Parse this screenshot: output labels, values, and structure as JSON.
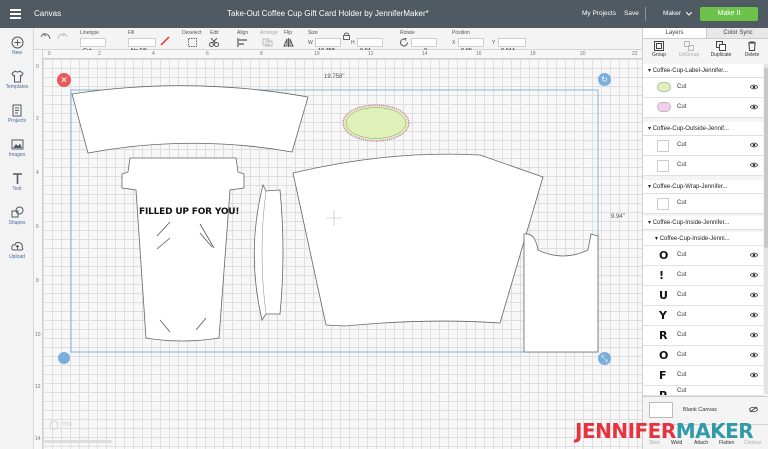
{
  "topbar": {
    "canvas_label": "Canvas",
    "doc_title": "Take-Out Coffee Cup Gift Card Holder by JenniferMaker*",
    "my_projects": "My Projects",
    "save": "Save",
    "machine": "Maker",
    "make_it": "Make It"
  },
  "toolbar": {
    "linetype_label": "Linetype",
    "linetype_value": "Cut",
    "fill_label": "Fill",
    "fill_value": "No Fill",
    "deselect_label": "Deselect",
    "edit_label": "Edit",
    "align_label": "Align",
    "arrange_label": "Arrange",
    "flip_label": "Flip",
    "size_label": "Size",
    "w_label": "W",
    "w_value": "19.758",
    "h_label": "H",
    "h_value": "9.94",
    "rotate_label": "Rotate",
    "rotate_value": "0",
    "position_label": "Position",
    "x_label": "X",
    "x_value": "0.99",
    "y_label": "Y",
    "y_value": "0.944"
  },
  "leftbar": {
    "items": [
      {
        "label": "New",
        "icon": "plus-icon"
      },
      {
        "label": "Templates",
        "icon": "shirt-icon"
      },
      {
        "label": "Projects",
        "icon": "projects-icon"
      },
      {
        "label": "Images",
        "icon": "image-icon"
      },
      {
        "label": "Text",
        "icon": "text-icon"
      },
      {
        "label": "Shapes",
        "icon": "shapes-icon"
      },
      {
        "label": "Upload",
        "icon": "upload-icon"
      }
    ]
  },
  "canvas": {
    "ruler_top": [
      "0",
      "2",
      "4",
      "6",
      "8",
      "10",
      "12",
      "14",
      "16",
      "18",
      "20",
      "22"
    ],
    "ruler_left": [
      "0",
      "2",
      "4",
      "6",
      "8",
      "10",
      "12",
      "14"
    ],
    "width_readout": "19.758\"",
    "height_readout": "9.94\"",
    "cup_text": "FILLED UP FOR YOU!",
    "zoom": "75%"
  },
  "panel": {
    "tabs": [
      "Layers",
      "Color Sync"
    ],
    "tools": [
      "Group",
      "UnGroup",
      "Duplicate",
      "Delete"
    ],
    "groups": [
      {
        "name": "Coffee-Cup-Label-Jennifer...",
        "layers": [
          {
            "label": "Cut",
            "color": "#dff0b8"
          },
          {
            "label": "Cut",
            "color": "#f3cdee"
          }
        ]
      },
      {
        "name": "Coffee-Cup-Outside-Jennif...",
        "layers": [
          {
            "label": "Cut",
            "color": "#ffffff"
          },
          {
            "label": "Cut",
            "color": "#ffffff"
          }
        ]
      },
      {
        "name": "Coffee-Cup-Wrap-Jennifer...",
        "layers": [
          {
            "label": "Cut",
            "color": "#ffffff"
          }
        ]
      },
      {
        "name": "Coffee-Cup-Inside-Jennifer..."
      }
    ],
    "subgroup": "Coffee-Cup-Inside-Jenni...",
    "letters": [
      {
        "glyph": "O",
        "label": "Cut"
      },
      {
        "glyph": "!",
        "label": "Cut"
      },
      {
        "glyph": "U",
        "label": "Cut"
      },
      {
        "glyph": "Y",
        "label": "Cut"
      },
      {
        "glyph": "R",
        "label": "Cut"
      },
      {
        "glyph": "O",
        "label": "Cut"
      },
      {
        "glyph": "F",
        "label": "Cut"
      },
      {
        "glyph": "P",
        "label": "Cut"
      }
    ],
    "blank_canvas": "Blank Canvas",
    "bottom_tools": [
      "Slice",
      "Weld",
      "Attach",
      "Flatten",
      "Contour"
    ]
  },
  "brand": {
    "part1": "JENNIFER",
    "part2": "MAKER",
    "color1": "#e5343f",
    "color2": "#2f9aa8"
  }
}
